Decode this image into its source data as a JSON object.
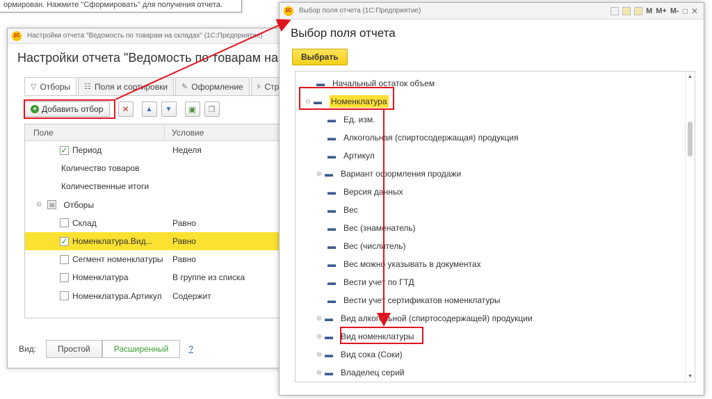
{
  "background_note": "ормирован. Нажмите \"Сформировать\" для получения отчета.",
  "left_window": {
    "titlebar_text": "Настройки отчета \"Ведомость по товарам на складах\" (1С:Предприятие)",
    "logo_text": "1С",
    "form_title": "Настройки отчета \"Ведомость по товарам на складах\"",
    "tabs": [
      {
        "label": "Отборы",
        "icon": "funnel-icon"
      },
      {
        "label": "Поля и сортировки",
        "icon": "fields-icon"
      },
      {
        "label": "Оформление",
        "icon": "brush-icon"
      },
      {
        "label": "Стр",
        "icon": "structure-icon"
      }
    ],
    "toolbar": {
      "add_filter_label": "Добавить отбор"
    },
    "grid": {
      "headers": [
        "Поле",
        "Условие"
      ],
      "rows": [
        {
          "field": "Период",
          "condition": "Неделя",
          "checked": true
        },
        {
          "field": "Количество товаров",
          "condition": ""
        },
        {
          "field": "Количественные итоги",
          "condition": ""
        },
        {
          "field": "Отборы",
          "condition": ""
        },
        {
          "field": "Склад",
          "condition": "Равно",
          "checked": false
        },
        {
          "field": "Номенклатура.Вид...",
          "condition": "Равно",
          "checked": true
        },
        {
          "field": "Сегмент номенклатуры",
          "condition": "Равно",
          "checked": false
        },
        {
          "field": "Номенклатура",
          "condition": "В группе из списка",
          "checked": false
        },
        {
          "field": "Номенклатура.Артикул",
          "condition": "Содержит",
          "checked": false
        }
      ]
    },
    "bottom": {
      "view_label": "Вид:",
      "simple": "Простой",
      "extended": "Расширенный",
      "help": "?"
    }
  },
  "right_window": {
    "titlebar_text": "Выбор поля отчета (1С:Предприятие)",
    "logo_text": "1С",
    "title_tools": [
      "M",
      "M+",
      "M-"
    ],
    "form_title": "Выбор поля отчета",
    "select_button": "Выбрать",
    "tree_items": [
      "Начальный остаток объем",
      "Номенклатура",
      "Ед. изм.",
      "Алкогольная (спиртосодержащая) продукция",
      "Артикул",
      "Вариант оформления продажи",
      "Версия данных",
      "Вес",
      "Вес (знаменатель)",
      "Вес (числитель)",
      "Вес можно указывать в документах",
      "Вести учет по ГТД",
      "Вести учет сертификатов номенклатуры",
      "Вид алкогольной (спиртосодержащей) продукции",
      "Вид номенклатуры",
      "Вид сока (Соки)",
      "Владелец серий"
    ]
  },
  "colors": {
    "highlight_yellow": "#fbe231",
    "annotation_red": "#e0141e",
    "accent_green": "#3a9a31"
  }
}
